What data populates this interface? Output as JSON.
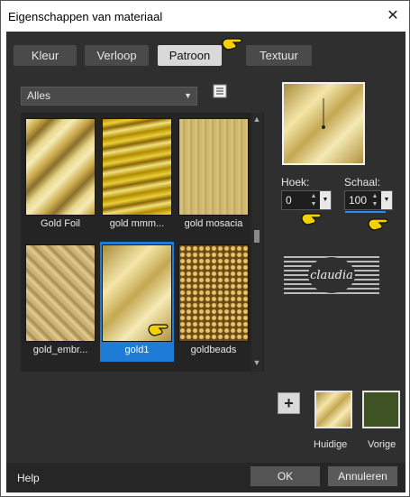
{
  "window": {
    "title": "Eigenschappen van materiaal",
    "close_glyph": "✕"
  },
  "tabs": [
    {
      "label": "Kleur"
    },
    {
      "label": "Verloop"
    },
    {
      "label": "Patroon",
      "active": true
    },
    {
      "label": "Textuur"
    }
  ],
  "filter": {
    "selected": "Alles"
  },
  "patterns": [
    {
      "label": "Gold Foil"
    },
    {
      "label": "gold mmm..."
    },
    {
      "label": "gold mosacia"
    },
    {
      "label": "gold_embr..."
    },
    {
      "label": "gold1",
      "selected": true
    },
    {
      "label": "goldbeads"
    }
  ],
  "angle": {
    "label": "Hoek:",
    "value": "0"
  },
  "scale": {
    "label": "Schaal:",
    "value": "100"
  },
  "logo": {
    "text": "claudia"
  },
  "swatches": {
    "current_label": "Huidige",
    "previous_label": "Vorige",
    "previous_color": "#3f5224"
  },
  "footer": {
    "help": "Help",
    "ok": "OK",
    "cancel": "Annuleren"
  }
}
